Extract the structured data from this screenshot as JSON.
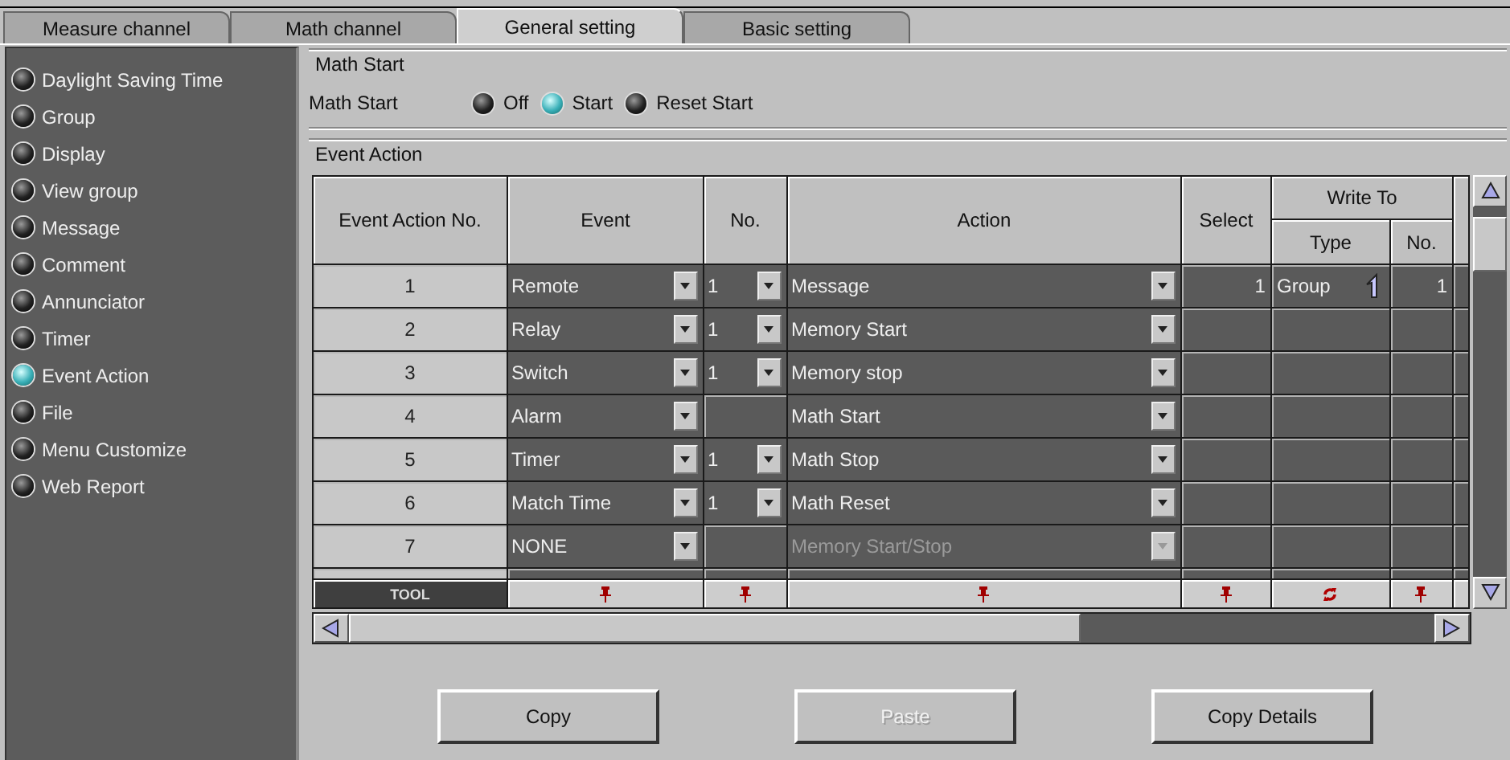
{
  "tabs": [
    {
      "label": "Measure channel",
      "selected": false
    },
    {
      "label": "Math channel",
      "selected": false
    },
    {
      "label": "General setting",
      "selected": true
    },
    {
      "label": "Basic setting",
      "selected": false
    }
  ],
  "sidebar": {
    "items": [
      {
        "label": "Daylight Saving Time",
        "selected": false
      },
      {
        "label": "Group",
        "selected": false
      },
      {
        "label": "Display",
        "selected": false
      },
      {
        "label": "View group",
        "selected": false
      },
      {
        "label": "Message",
        "selected": false
      },
      {
        "label": "Comment",
        "selected": false
      },
      {
        "label": "Annunciator",
        "selected": false
      },
      {
        "label": "Timer",
        "selected": false
      },
      {
        "label": "Event Action",
        "selected": true
      },
      {
        "label": "File",
        "selected": false
      },
      {
        "label": "Menu Customize",
        "selected": false
      },
      {
        "label": "Web Report",
        "selected": false
      }
    ]
  },
  "math_start": {
    "title": "Math Start",
    "label": "Math Start",
    "options": [
      {
        "label": "Off",
        "selected": false
      },
      {
        "label": "Start",
        "selected": true
      },
      {
        "label": "Reset Start",
        "selected": false
      }
    ]
  },
  "event_action": {
    "title": "Event Action",
    "columns": [
      "Event Action No.",
      "Event",
      "No.",
      "Action",
      "Select"
    ],
    "write_to": {
      "label": "Write To",
      "columns": [
        "Type",
        "No."
      ]
    },
    "rows": [
      {
        "number": "1",
        "event": "Remote",
        "event_no": "1",
        "action": "Message",
        "action_disabled": false,
        "select": "1",
        "type": "Group",
        "type_no": "1"
      },
      {
        "number": "2",
        "event": "Relay",
        "event_no": "1",
        "action": "Memory Start",
        "action_disabled": false
      },
      {
        "number": "3",
        "event": "Switch",
        "event_no": "1",
        "action": "Memory stop",
        "action_disabled": false
      },
      {
        "number": "4",
        "event": "Alarm",
        "action": "Math Start",
        "action_disabled": false
      },
      {
        "number": "5",
        "event": "Timer",
        "event_no": "1",
        "action": "Math Stop",
        "action_disabled": false
      },
      {
        "number": "6",
        "event": "Match Time",
        "event_no": "1",
        "action": "Math Reset",
        "action_disabled": false
      },
      {
        "number": "7",
        "event": "NONE",
        "action": "Memory Start/Stop",
        "action_disabled": true
      }
    ],
    "tool_row": {
      "label": "TOOL",
      "tools": [
        {
          "kind": "pin"
        },
        {
          "kind": "pin"
        },
        {
          "kind": "pin"
        },
        {
          "kind": "pin"
        },
        {
          "kind": "refresh"
        },
        {
          "kind": "pin"
        }
      ]
    }
  },
  "buttons": [
    {
      "label": "Copy",
      "disabled": false
    },
    {
      "label": "Paste",
      "disabled": true
    },
    {
      "label": "Copy Details",
      "disabled": false
    }
  ]
}
